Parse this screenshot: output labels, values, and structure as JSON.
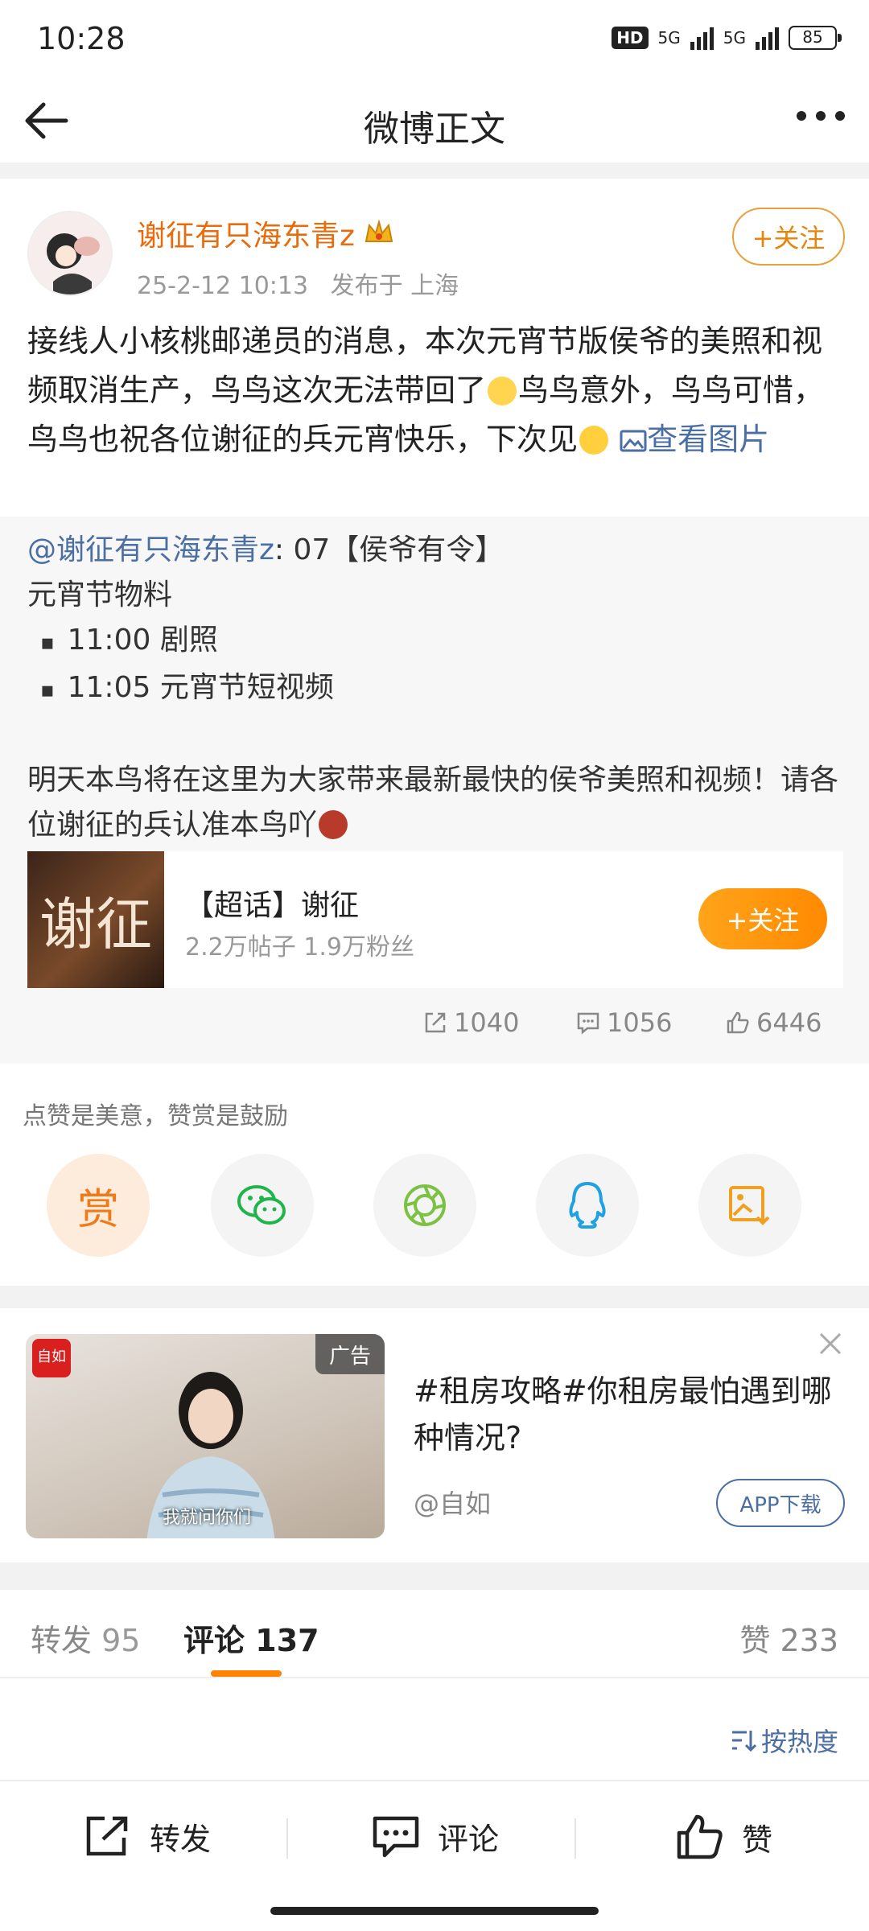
{
  "status_bar": {
    "time": "10:28",
    "hd": "HD",
    "network_1": "5G",
    "network_2": "5G",
    "battery": "85"
  },
  "nav": {
    "title": "微博正文"
  },
  "post": {
    "username": "谢征有只海东青z",
    "timestamp": "25-2-12 10:13",
    "location": "发布于 上海",
    "follow_label": "+关注",
    "text_part1": "接线人小核桃邮递员的消息，本次元宵节版侯爷的美照和视频取消生产，鸟鸟这次无法带回了",
    "text_part2": "鸟鸟意外，鸟鸟可惜，鸟鸟也祝各位谢征的兵元宵快乐，下次见",
    "view_image_link": "查看图片"
  },
  "quote": {
    "author": "@谢征有只海东青z",
    "line1_rest": ": 07【侯爷有令】",
    "line2": "元宵节物料",
    "bullets": [
      "11:00 剧照",
      "11:05 元宵节短视频"
    ],
    "paragraph": "明天本鸟将在这里为大家带来最新最快的侯爷美照和视频！请各位谢征的兵认准本鸟吖",
    "supertopic": {
      "cover_text": "谢征",
      "name": "【超话】谢征",
      "stats": "2.2万帖子  1.9万粉丝",
      "follow_label": "+关注"
    },
    "counts": {
      "reposts": "1040",
      "comments": "1056",
      "likes": "6446"
    }
  },
  "reward": {
    "tip": "点赞是美意，赞赏是鼓励",
    "reward_label": "赏",
    "share_targets": [
      "wechat-icon",
      "moments-icon",
      "qq-icon",
      "save-image-icon"
    ]
  },
  "ad": {
    "tag": "广告",
    "logo_text": "自如",
    "image_subtitle": "我就问你们",
    "title": "#租房攻略#你租房最怕遇到哪种情况?",
    "source": "@自如",
    "button_label": "APP下载"
  },
  "tabs": {
    "repost_label": "转发",
    "repost_count": "95",
    "comment_label": "评论",
    "comment_count": "137",
    "like_label": "赞",
    "like_count": "233"
  },
  "sort": {
    "label": "按热度"
  },
  "bottom_bar": {
    "repost": "转发",
    "comment": "评论",
    "like": "赞"
  },
  "colors": {
    "accent": "#ff8200",
    "link": "#4b6ea3",
    "username": "#e86b0c"
  }
}
